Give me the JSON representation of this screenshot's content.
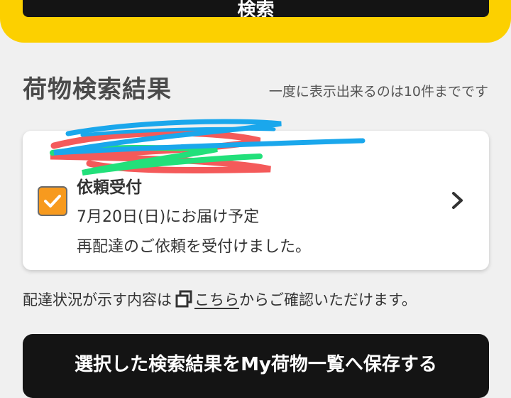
{
  "search": {
    "button_label": "検索"
  },
  "results": {
    "title": "荷物検索結果",
    "limit_note": "一度に表示出来るのは10件までです",
    "items": [
      {
        "checked": true,
        "status": "依頼受付",
        "delivery_date": "7月20日(日)にお届け予定",
        "message": "再配達のご依頼を受付けました。"
      }
    ]
  },
  "info": {
    "prefix": "配達状況が示す内容は",
    "link_label": "こちら",
    "suffix": "からご確認いただけます。"
  },
  "actions": {
    "save_label": "選択した検索結果をMy荷物一覧へ保存する"
  },
  "colors": {
    "accent_yellow": "#fcd000",
    "checkbox_orange": "#f79a1e",
    "button_dark": "#141414",
    "background": "#f0f0f0"
  }
}
